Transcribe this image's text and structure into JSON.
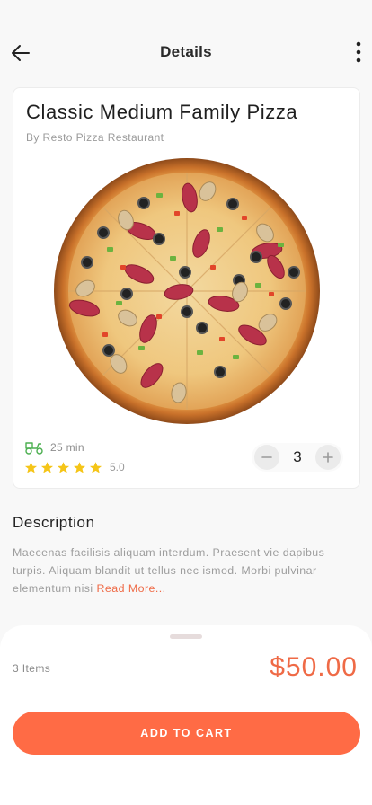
{
  "header": {
    "title": "Details",
    "back_icon": "arrow-left-icon",
    "menu_icon": "more-vertical-icon"
  },
  "product": {
    "name": "Classic Medium Family Pizza",
    "restaurant": "By Resto Pizza Restaurant",
    "delivery_time": "25 min",
    "rating": "5.0",
    "stars": 5,
    "quantity": "3"
  },
  "description": {
    "title": "Description",
    "text": "Maecenas facilisis aliquam interdum. Praesent vie dapibus turpis. Aliquam blandit ut tellus nec ismod. Morbi pulvinar elementum nisi ",
    "read_more": "Read More..."
  },
  "cart": {
    "items_label": "3 Items",
    "total": "$50.00",
    "button_label": "ADD TO CART"
  },
  "colors": {
    "accent": "#ff6b45",
    "price": "#ef6a46",
    "star": "#f5c518",
    "delivery_icon": "#4caf50"
  }
}
